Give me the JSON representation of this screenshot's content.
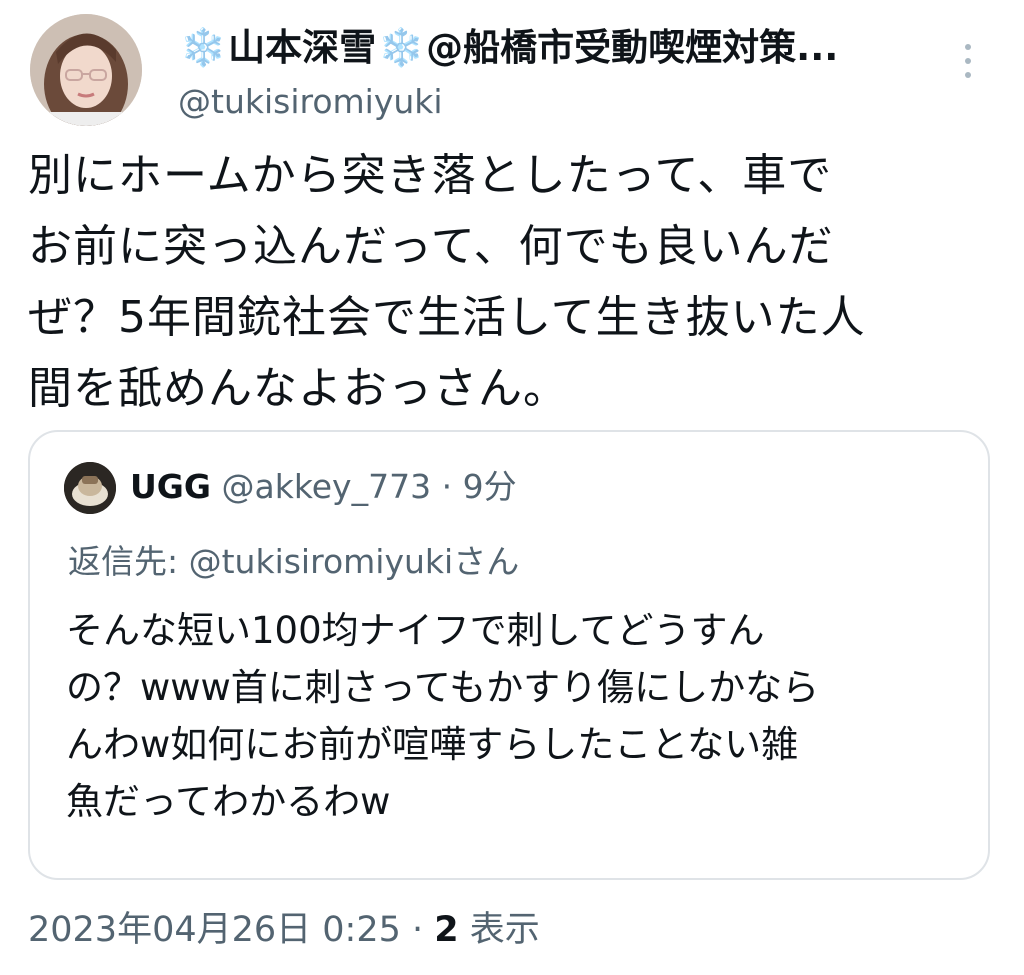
{
  "author": {
    "snowflake": "❄️",
    "name": "山本深雪",
    "name_suffix": "@船橋市受動喫煙対策",
    "ellipsis": "...",
    "handle": "@tukisiromiyuki"
  },
  "tweet": {
    "text": "別にホームから突き落としたって、車で\nお前に突っ込んだって、何でも良いんだ\nぜ？5年間銃社会で生活して生き抜いた人\n間を舐めんなよおっさん。"
  },
  "quote": {
    "name": "UGG",
    "handle": "@akkey_773",
    "dot": "·",
    "time": "9分",
    "reply_prefix": "返信先: ",
    "reply_handle": "@tukisiromiyuki",
    "reply_suffix": "さん",
    "text": "そんな短い100均ナイフで刺してどうすん\nの？www首に刺さってもかすり傷にしかなら\nんわw如何にお前が喧嘩すらしたことない雑\n魚だってわかるわw"
  },
  "footer": {
    "timestamp": "2023年04月26日 0:25",
    "dot": "·",
    "views_count": "2",
    "views_label": "表示"
  },
  "colors": {
    "text": "#0f1419",
    "secondary": "#536471",
    "border": "#dfe3e7",
    "snowflake": "#7fb3e6"
  }
}
